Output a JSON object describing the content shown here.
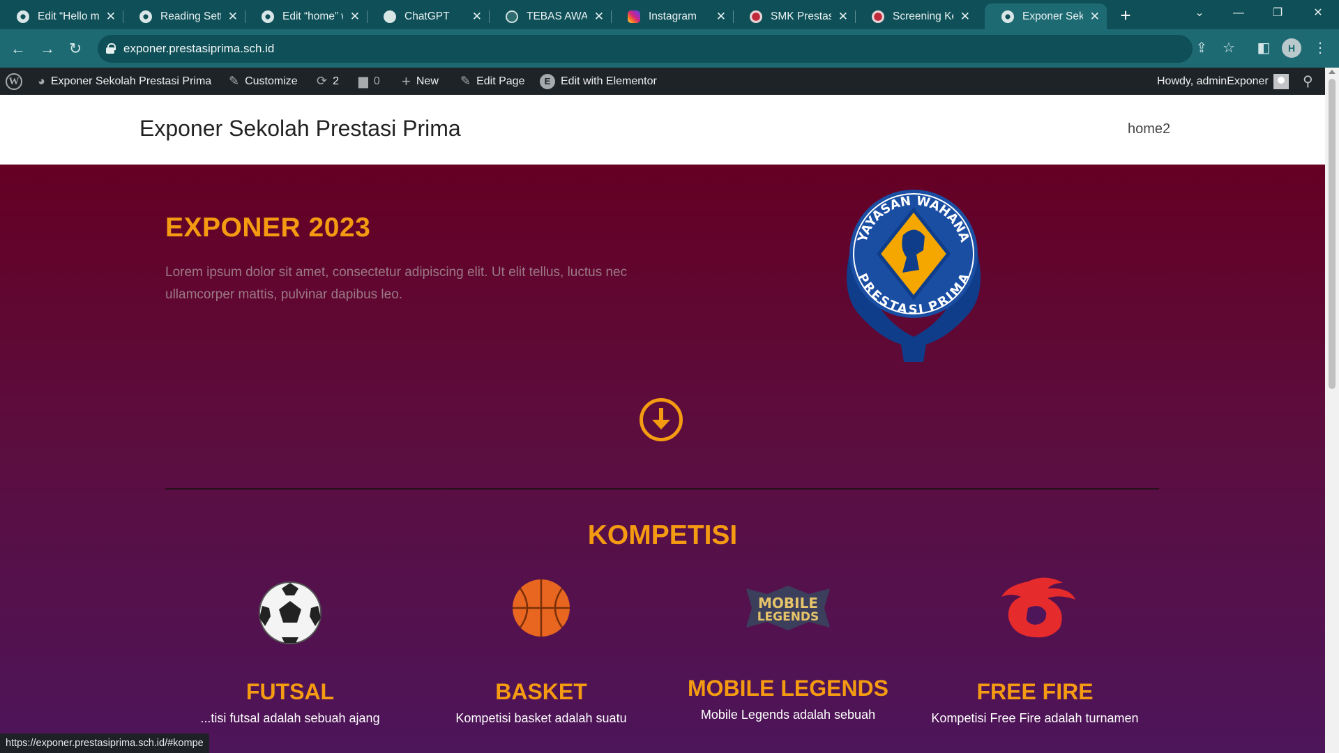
{
  "browser": {
    "tabs": [
      {
        "title": "Edit “Hello ma",
        "icon": "wordpress-globe-icon",
        "active": false
      },
      {
        "title": "Reading Settin",
        "icon": "wordpress-globe-icon",
        "active": false
      },
      {
        "title": "Edit “home” w",
        "icon": "wordpress-globe-icon",
        "active": false
      },
      {
        "title": "ChatGPT",
        "icon": "chatgpt-icon",
        "active": false
      },
      {
        "title": "TEBAS AWARD",
        "icon": "tebas-icon",
        "active": false
      },
      {
        "title": "Instagram",
        "icon": "instagram-icon",
        "active": false
      },
      {
        "title": "SMK Prestasi P",
        "icon": "smk-icon",
        "active": false
      },
      {
        "title": "Screening Kes",
        "icon": "smk-icon",
        "active": false
      },
      {
        "title": "Exponer Sekol",
        "icon": "wordpress-globe-icon",
        "active": true
      }
    ],
    "new_tab": "+",
    "url": "exponer.prestasiprima.sch.id",
    "profile_initial": "H",
    "status_url": "https://exponer.prestasiprima.sch.id/#kompe"
  },
  "adminbar": {
    "site_name": "Exponer Sekolah Prestasi Prima",
    "customize": "Customize",
    "updates_count": "2",
    "comments_count": "0",
    "new": "New",
    "edit_page": "Edit Page",
    "edit_elementor": "Edit with Elementor",
    "elementor_letter": "E",
    "howdy": "Howdy, adminExponer"
  },
  "site": {
    "title": "Exponer Sekolah Prestasi Prima",
    "menu_item": "home2"
  },
  "hero": {
    "title": "EXPONER 2023",
    "text": "Lorem ipsum dolor sit amet, consectetur adipiscing elit. Ut elit tellus, luctus nec ullamcorper mattis, pulvinar dapibus leo.",
    "logo_top_text": "YAYASAN WAHANA",
    "logo_bottom_text": "PRESTASI PRIMA"
  },
  "kompetisi": {
    "title": "KOMPETISI",
    "cards": [
      {
        "name": "FUTSAL",
        "icon": "soccer-ball-icon",
        "desc": "...tisi futsal adalah sebuah ajang"
      },
      {
        "name": "BASKET",
        "icon": "basketball-icon",
        "desc": "Kompetisi basket adalah suatu"
      },
      {
        "name": "MOBILE LEGENDS",
        "icon": "mobile-legends-logo",
        "logo_text_1": "MOBILE",
        "logo_text_2": "LEGENDS",
        "desc": "Mobile Legends adalah sebuah"
      },
      {
        "name": "FREE FIRE",
        "icon": "free-fire-logo",
        "desc": "Kompetisi Free Fire adalah turnamen"
      }
    ]
  },
  "colors": {
    "accent": "#f59b12",
    "hero_top": "#650023",
    "hero_bottom": "#4d155a",
    "browser_frame": "#0f4f57",
    "adminbar": "#1d2327"
  }
}
